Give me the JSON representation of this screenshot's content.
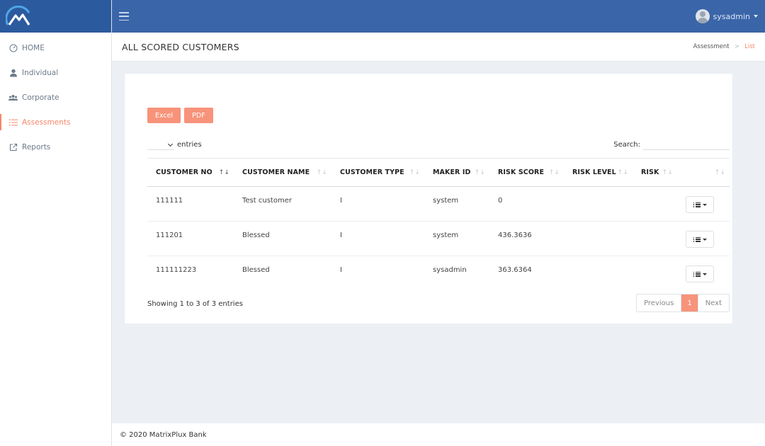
{
  "colors": {
    "topbar": "#3a65a8",
    "brand": "#2c5a9e",
    "accent": "#f7876a",
    "button": "#f7937a"
  },
  "header": {
    "username": "sysadmin"
  },
  "sidebar": {
    "items": [
      {
        "label": "HOME",
        "icon": "gauge-icon"
      },
      {
        "label": "Individual",
        "icon": "user-icon"
      },
      {
        "label": "Corporate",
        "icon": "users-icon"
      },
      {
        "label": "Assessments",
        "icon": "list-icon",
        "active": true
      },
      {
        "label": "Reports",
        "icon": "external-link-icon"
      }
    ]
  },
  "page": {
    "title": "ALL SCORED CUSTOMERS",
    "breadcrumb": {
      "parent": "Assessment",
      "current": "List"
    }
  },
  "toolbar": {
    "excel_label": "Excel",
    "pdf_label": "PDF"
  },
  "table_controls": {
    "entries_label": "entries",
    "search_label": "Search:"
  },
  "table": {
    "columns": [
      "CUSTOMER NO",
      "CUSTOMER NAME",
      "CUSTOMER TYPE",
      "MAKER ID",
      "RISK SCORE",
      "RISK LEVEL",
      "RISK",
      ""
    ],
    "rows": [
      {
        "customer_no": "111111",
        "customer_name": "Test customer",
        "customer_type": "I",
        "maker_id": "system",
        "risk_score": "0",
        "risk_level": "",
        "risk": ""
      },
      {
        "customer_no": "111201",
        "customer_name": "Blessed",
        "customer_type": "I",
        "maker_id": "system",
        "risk_score": "436.3636",
        "risk_level": "",
        "risk": ""
      },
      {
        "customer_no": "111111223",
        "customer_name": "Blessed",
        "customer_type": "I",
        "maker_id": "sysadmin",
        "risk_score": "363.6364",
        "risk_level": "",
        "risk": ""
      }
    ]
  },
  "pagination": {
    "info": "Showing 1 to 3 of 3 entries",
    "previous": "Previous",
    "current": "1",
    "next": "Next"
  },
  "footer": {
    "text": "© 2020 MatrixPlux Bank"
  }
}
